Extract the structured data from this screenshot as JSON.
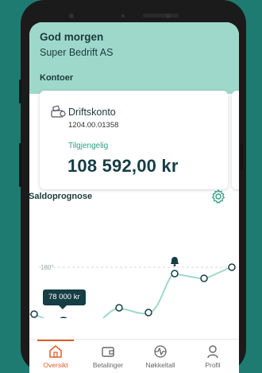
{
  "header": {
    "greeting": "God morgen",
    "company": "Super Bedrift AS",
    "section_title": "Kontoer"
  },
  "account": {
    "name": "Driftskonto",
    "number": "1204.00.01358",
    "available_label": "Tilgjengelig",
    "balance": "108 592,00 kr",
    "icon": "account-icon"
  },
  "forecast": {
    "title": "Saldoprognose",
    "settings_icon": "gear-icon",
    "reference_label": "180°",
    "tooltip": "78 000  kr",
    "alert_icon": "bell-icon"
  },
  "nav": {
    "items": [
      {
        "label": "Oversikt",
        "icon": "home-icon",
        "active": true
      },
      {
        "label": "Betalinger",
        "icon": "wallet-icon",
        "active": false
      },
      {
        "label": "Nøkkeltall",
        "icon": "pulse-icon",
        "active": false
      },
      {
        "label": "Profil",
        "icon": "user-icon",
        "active": false
      }
    ]
  },
  "colors": {
    "accent": "#2f9d86",
    "header_bg": "#9ed8cb",
    "nav_active": "#e35d2b",
    "dark": "#173d45",
    "background": "#1e7b72"
  }
}
